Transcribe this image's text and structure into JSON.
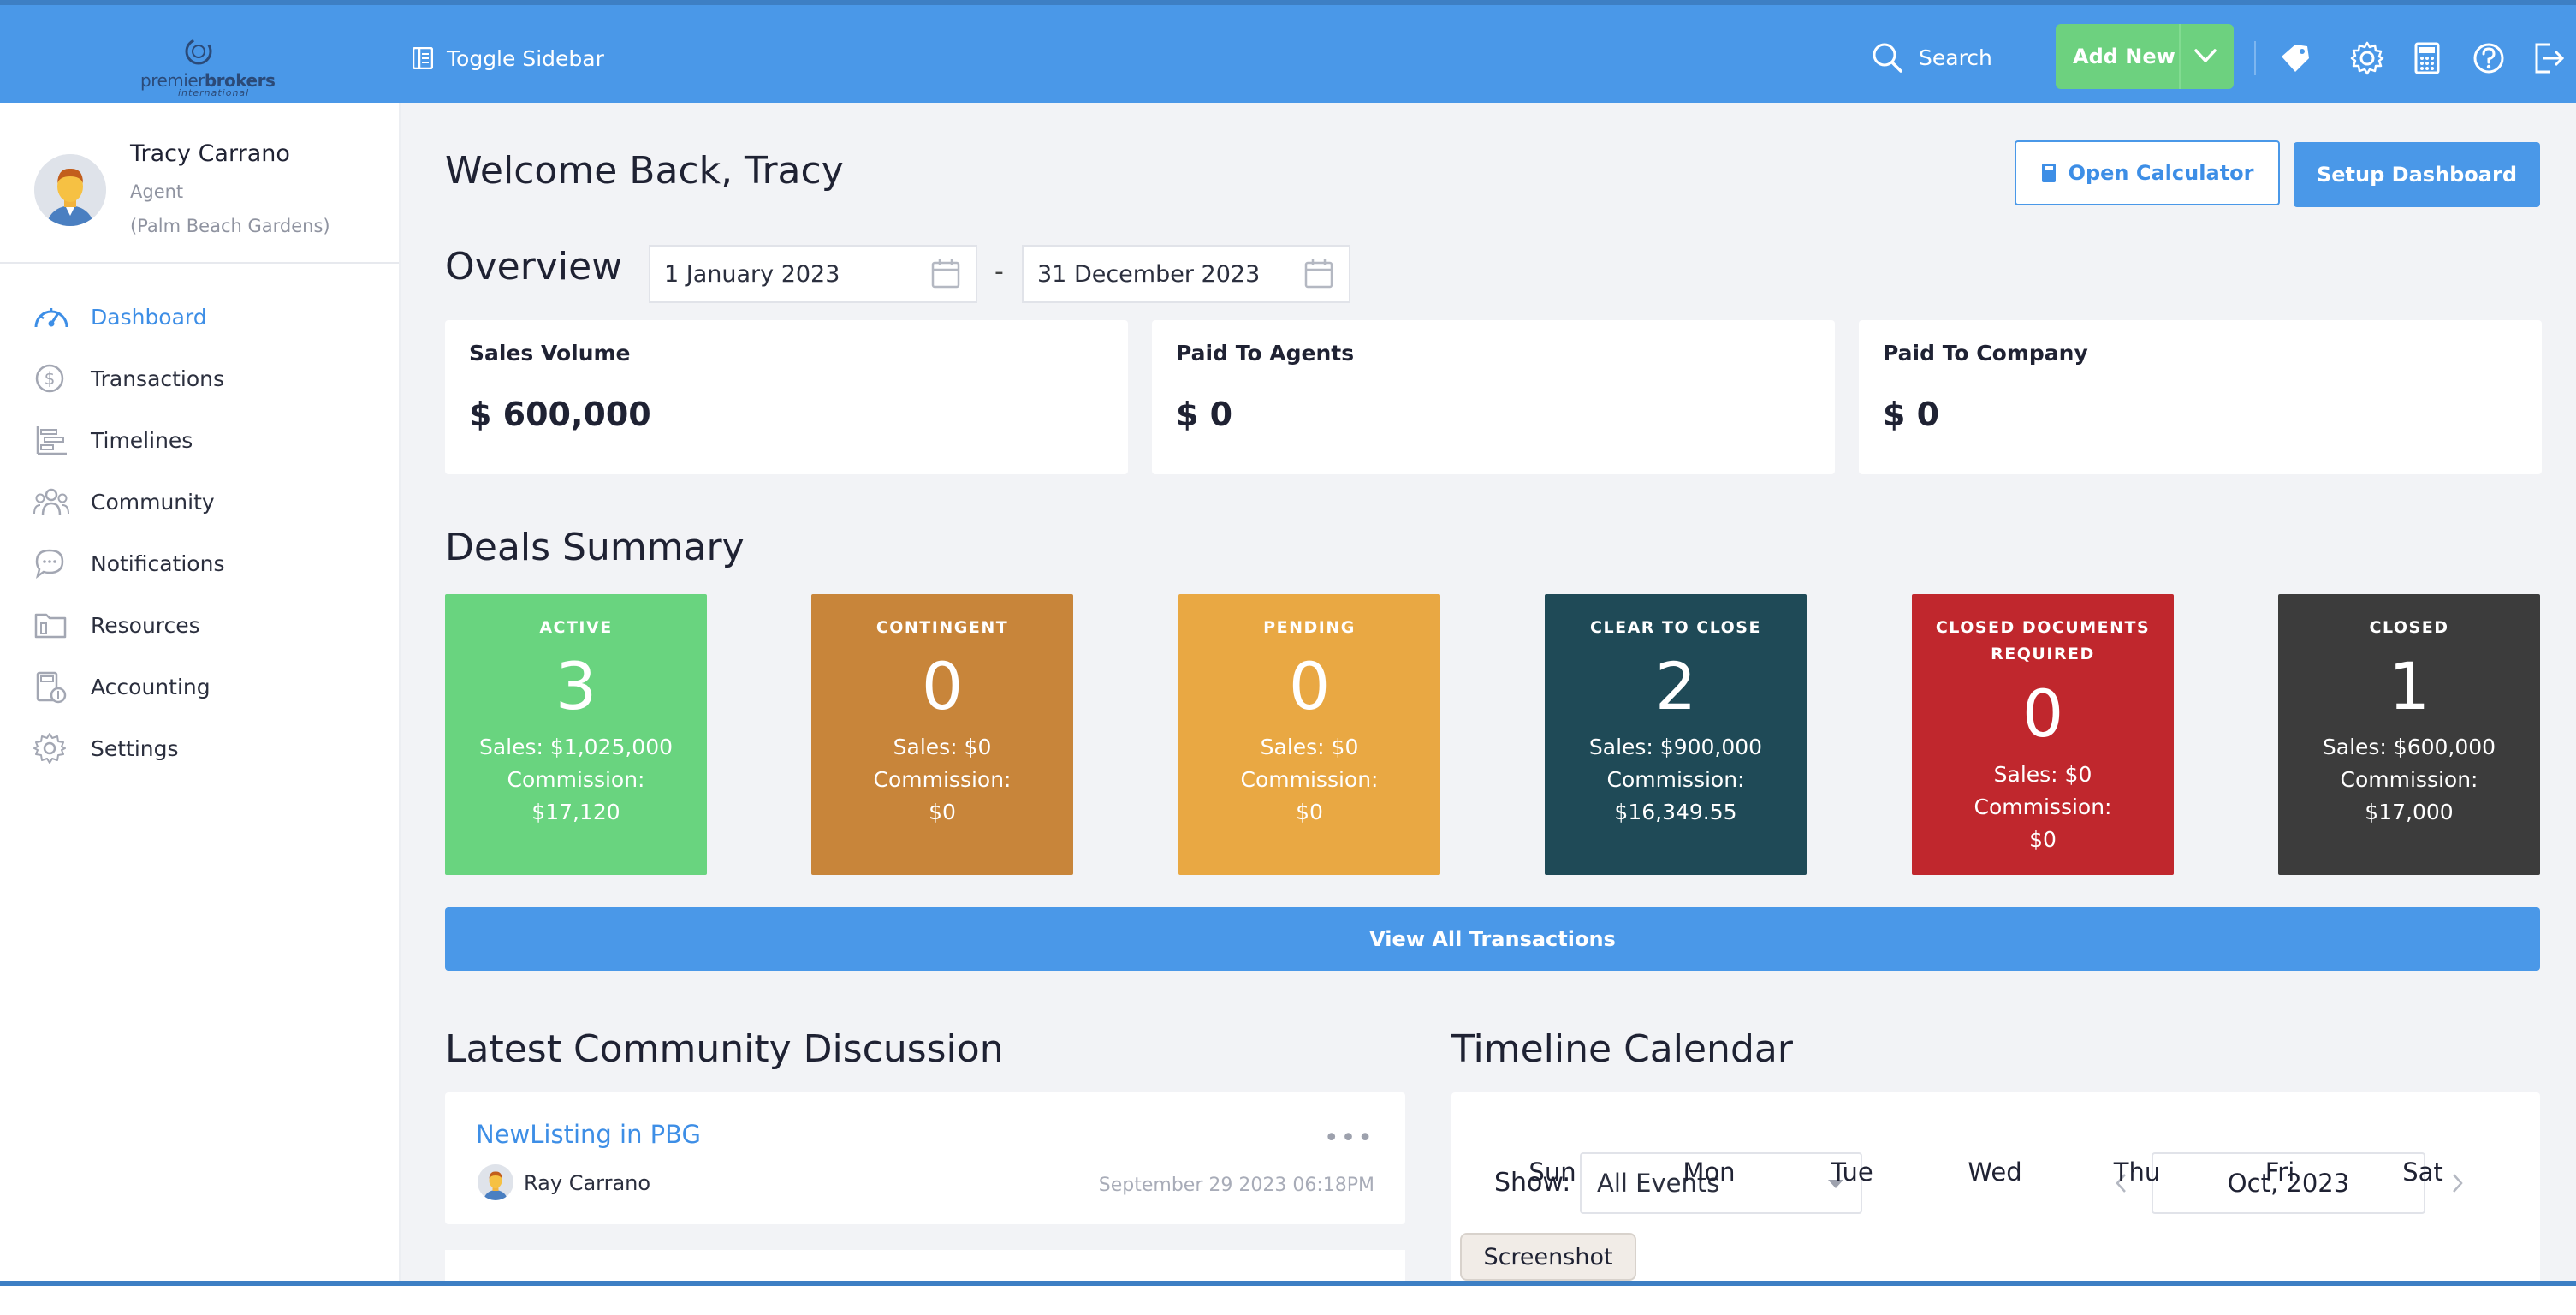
{
  "brand": {
    "logo_text_a": "premier",
    "logo_text_b": "brokers",
    "logo_sub": "international"
  },
  "topbar": {
    "toggle_label": "Toggle Sidebar",
    "search_label": "Search",
    "add_new_label": "Add New",
    "icons": [
      "tag-icon",
      "gear-icon",
      "calculator-icon",
      "help-icon",
      "logout-icon"
    ]
  },
  "profile": {
    "name": "Tracy Carrano",
    "role": "Agent",
    "location": "(Palm Beach Gardens)"
  },
  "nav": [
    {
      "label": "Dashboard",
      "icon": "dashboard-icon",
      "active": true
    },
    {
      "label": "Transactions",
      "icon": "dollar-icon"
    },
    {
      "label": "Timelines",
      "icon": "timeline-icon"
    },
    {
      "label": "Community",
      "icon": "community-icon"
    },
    {
      "label": "Notifications",
      "icon": "chat-icon"
    },
    {
      "label": "Resources",
      "icon": "folder-icon"
    },
    {
      "label": "Accounting",
      "icon": "accounting-icon"
    },
    {
      "label": "Settings",
      "icon": "gear-icon"
    }
  ],
  "main": {
    "welcome": "Welcome Back, Tracy",
    "open_calculator": "Open Calculator",
    "setup_dashboard": "Setup Dashboard",
    "overview_title": "Overview",
    "date_from": "1 January 2023",
    "date_sep": "-",
    "date_to": "31 December 2023"
  },
  "stats": [
    {
      "title": "Sales Volume",
      "value": "$ 600,000"
    },
    {
      "title": "Paid To Agents",
      "value": "$ 0"
    },
    {
      "title": "Paid To Company",
      "value": "$ 0"
    }
  ],
  "deals_title": "Deals Summary",
  "deals": [
    {
      "title_lines": [
        "ACTIVE"
      ],
      "count": "3",
      "sales": "Sales: $1,025,000",
      "commission_label": "Commission:",
      "commission": "$17,120",
      "color": "#69d47f"
    },
    {
      "title_lines": [
        "CONTINGENT"
      ],
      "count": "0",
      "sales": "Sales: $0",
      "commission_label": "Commission:",
      "commission": "$0",
      "color": "#c8853a"
    },
    {
      "title_lines": [
        "PENDING"
      ],
      "count": "0",
      "sales": "Sales: $0",
      "commission_label": "Commission:",
      "commission": "$0",
      "color": "#e9a843"
    },
    {
      "title_lines": [
        "CLEAR TO CLOSE"
      ],
      "count": "2",
      "sales": "Sales: $900,000",
      "commission_label": "Commission:",
      "commission": "$16,349.55",
      "color": "#1f4a57"
    },
    {
      "title_lines": [
        "CLOSED DOCUMENTS",
        "REQUIRED"
      ],
      "count": "0",
      "sales": "Sales: $0",
      "commission_label": "Commission:",
      "commission": "$0",
      "color": "#c0272d"
    },
    {
      "title_lines": [
        "CLOSED"
      ],
      "count": "1",
      "sales": "Sales: $600,000",
      "commission_label": "Commission:",
      "commission": "$17,000",
      "color": "#3c3c3c"
    }
  ],
  "view_all": "View All Transactions",
  "community": {
    "title": "Latest Community Discussion",
    "post_title": "NewListing in PBG",
    "author": "Ray Carrano",
    "date": "September 29 2023 06:18PM",
    "more": "•••"
  },
  "calendar": {
    "title": "Timeline Calendar",
    "show_label": "Show:",
    "filter_value": "All Events",
    "month": "Oct, 2023",
    "weekdays": [
      "Sun",
      "Mon",
      "Tue",
      "Wed",
      "Thu",
      "Fri",
      "Sat"
    ]
  },
  "screenshot_label": "Screenshot",
  "colors": {
    "topbar": "#4a98e8",
    "accent": "#3d8ee6",
    "add_new": "#6dd17f"
  }
}
